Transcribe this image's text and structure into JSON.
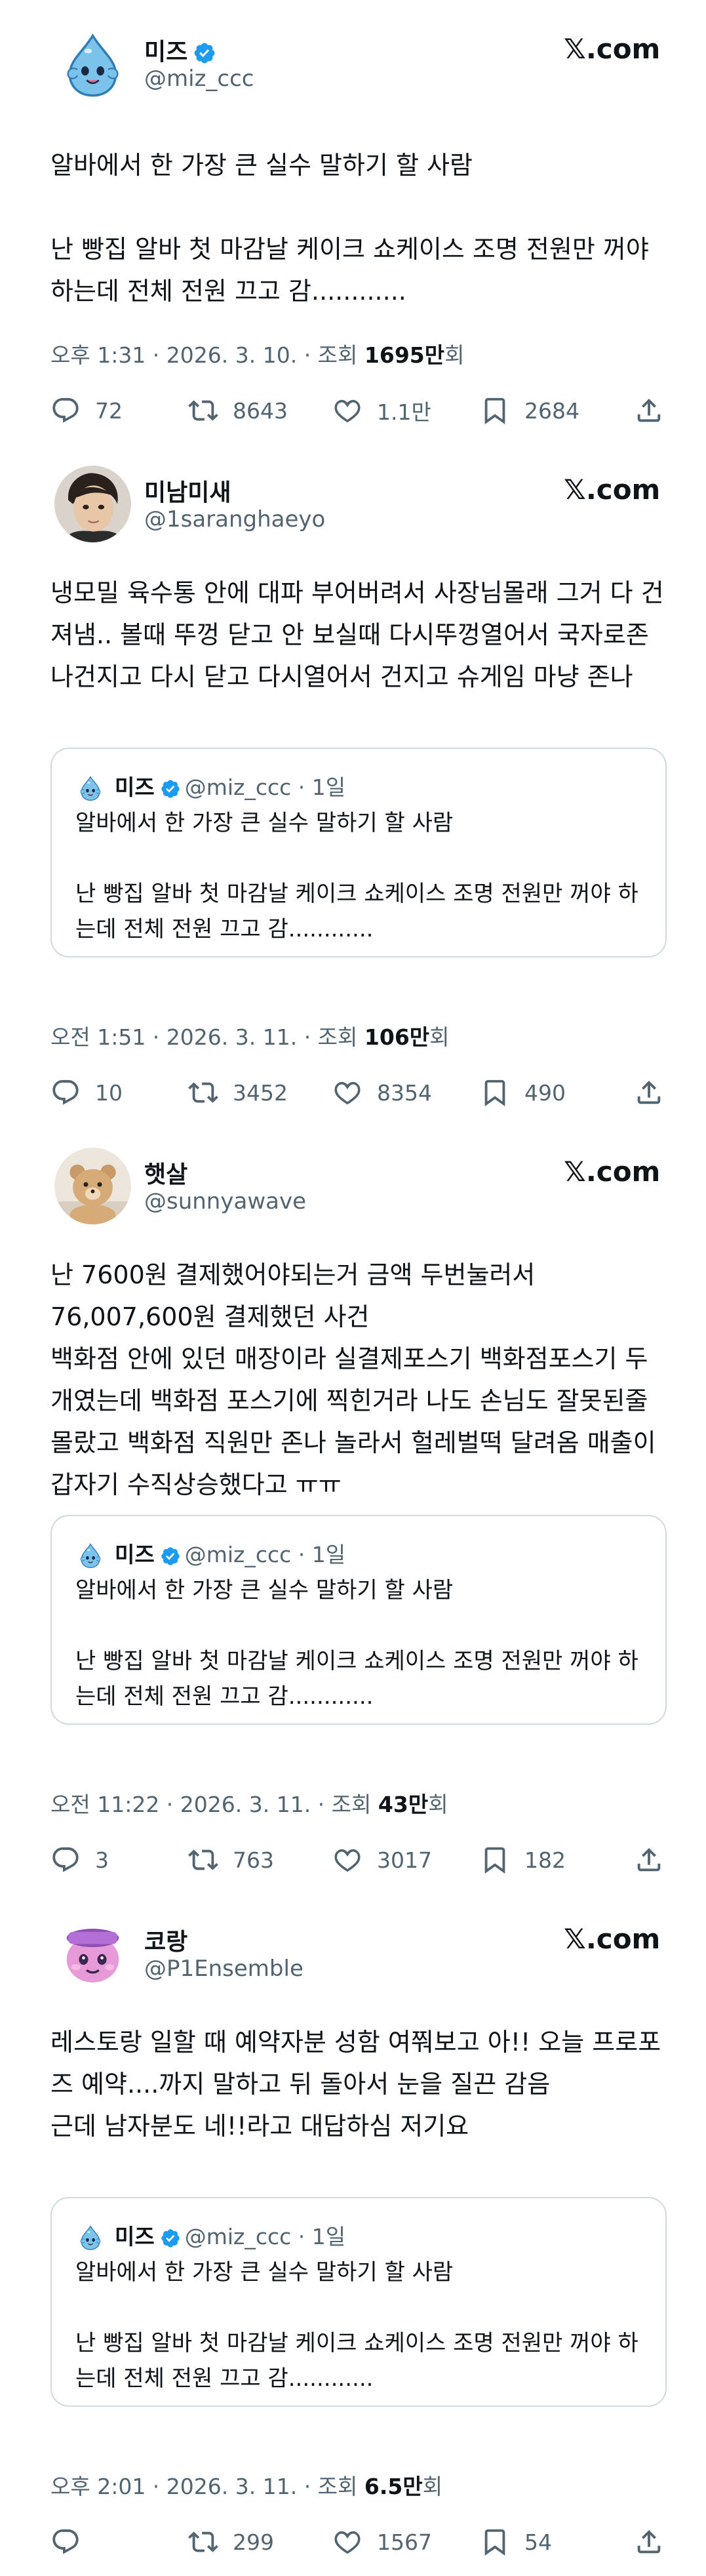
{
  "brand_label": "𝕏.com",
  "posts": [
    {
      "name": "미즈",
      "handle": "@miz_ccc",
      "verified": true,
      "text": "알바에서 한 가장 큰 실수 말하기 할 사람\n\n난 빵집 알바 첫 마감날 케이크 쇼케이스 조명 전원만 꺼야 하는데 전체 전원 끄고 감............",
      "time": "오후 1:31 · 2026. 3. 10. · 조회 ",
      "views": "1695만",
      "views_suffix": "회",
      "replies": "72",
      "retweets": "8643",
      "likes": "1.1만",
      "bookmarks": "2684"
    },
    {
      "name": "미남미새",
      "handle": "@1saranghaeyo",
      "verified": false,
      "text": "냉모밀 육수통 안에 대파 부어버려서 사장님몰래 그거 다 건져냄.. 볼때 뚜껑 닫고 안 보실때 다시뚜껑열어서 국자로존나건지고 다시 닫고 다시열어서 건지고 슈게임 마냥 존나",
      "quote": {
        "name": "미즈",
        "handle": "@miz_ccc · 1일",
        "text": "알바에서 한 가장 큰 실수 말하기 할 사람\n\n난 빵집 알바 첫 마감날 케이크 쇼케이스 조명 전원만 꺼야 하는데 전체 전원 끄고 감............"
      },
      "time": "오전 1:51 · 2026. 3. 11. · 조회 ",
      "views": "106만",
      "views_suffix": "회",
      "replies": "10",
      "retweets": "3452",
      "likes": "8354",
      "bookmarks": "490"
    },
    {
      "name": "햇살",
      "handle": "@sunnyawave",
      "verified": false,
      "text": "난 7600원 결제했어야되는거 금액 두번눌러서\n76,007,600원 결제했던 사건\n백화점 안에 있던 매장이라 실결제포스기 백화점포스기 두개였는데 백화점 포스기에 찍힌거라 나도 손님도 잘못된줄 몰랐고 백화점 직원만 존나 놀라서 헐레벌떡 달려옴 매출이 갑자기 수직상승했다고 ㅠㅠ",
      "quote": {
        "name": "미즈",
        "handle": "@miz_ccc · 1일",
        "text": "알바에서 한 가장 큰 실수 말하기 할 사람\n\n난 빵집 알바 첫 마감날 케이크 쇼케이스 조명 전원만 꺼야 하는데 전체 전원 끄고 감............"
      },
      "time": "오전 11:22 · 2026. 3. 11. · 조회 ",
      "views": "43만",
      "views_suffix": "회",
      "replies": "3",
      "retweets": "763",
      "likes": "3017",
      "bookmarks": "182"
    },
    {
      "name": "코랑",
      "handle": "@P1Ensemble",
      "verified": false,
      "text": "레스토랑 일할 때 예약자분 성함 여쭤보고 아!! 오늘 프로포즈 예약....까지 말하고 뒤 돌아서 눈을 질끈 감음\n근데 남자분도 네!!라고 대답하심 저기요",
      "quote": {
        "name": "미즈",
        "handle": "@miz_ccc · 1일",
        "text": "알바에서 한 가장 큰 실수 말하기 할 사람\n\n난 빵집 알바 첫 마감날 케이크 쇼케이스 조명 전원만 꺼야 하는데 전체 전원 끄고 감............"
      },
      "time": "오후 2:01 · 2026. 3. 11. · 조회 ",
      "views": "6.5만",
      "views_suffix": "회",
      "replies": "",
      "retweets": "299",
      "likes": "1567",
      "bookmarks": "54"
    }
  ],
  "colors": {
    "text": "#0f1419",
    "muted": "#536471",
    "border": "#cfd9de",
    "verified": "#1d9bf0"
  }
}
